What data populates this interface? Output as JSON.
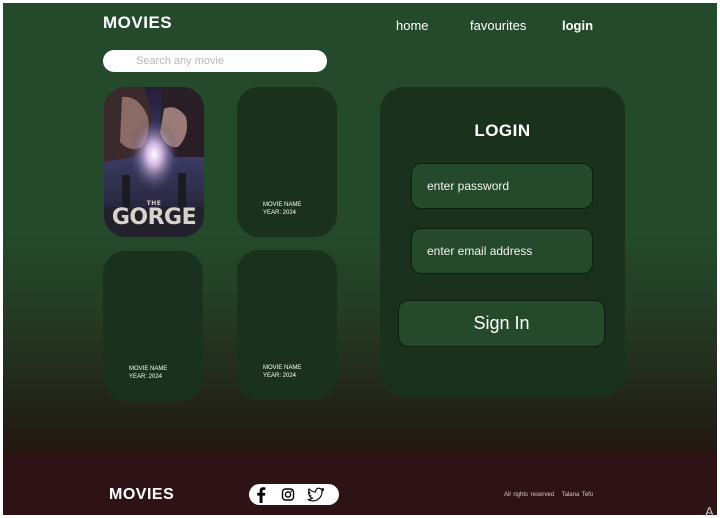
{
  "header": {
    "brand": "MOVIES",
    "nav": [
      "home",
      "favourites",
      "login"
    ],
    "active_nav": "login"
  },
  "search": {
    "placeholder": "Search any movie",
    "value": ""
  },
  "movies": [
    {
      "poster_small_text": "THE",
      "poster_big_text": "GORGE",
      "has_poster": true
    },
    {
      "name": "MOVIE NAME",
      "year": "YEAR: 2024"
    },
    {
      "name": "MOVIE NAME",
      "year": "YEAR: 2024"
    },
    {
      "name": "MOVIE NAME",
      "year": "YEAR: 2024"
    }
  ],
  "login": {
    "title": "LOGIN",
    "password_placeholder": "enter password",
    "email_placeholder": "enter email address",
    "submit_label": "Sign In"
  },
  "footer": {
    "brand": "MOVIES",
    "socials": [
      "facebook-icon",
      "instagram-icon",
      "twitter-icon"
    ],
    "rights": "All rights reserved",
    "author": "Talana Tefo"
  },
  "corner_glyph": "A",
  "colors": {
    "bg_green": "#244a2b",
    "card_green": "#1a311d",
    "footer_maroon": "#2d1315",
    "text": "#ffffff"
  }
}
